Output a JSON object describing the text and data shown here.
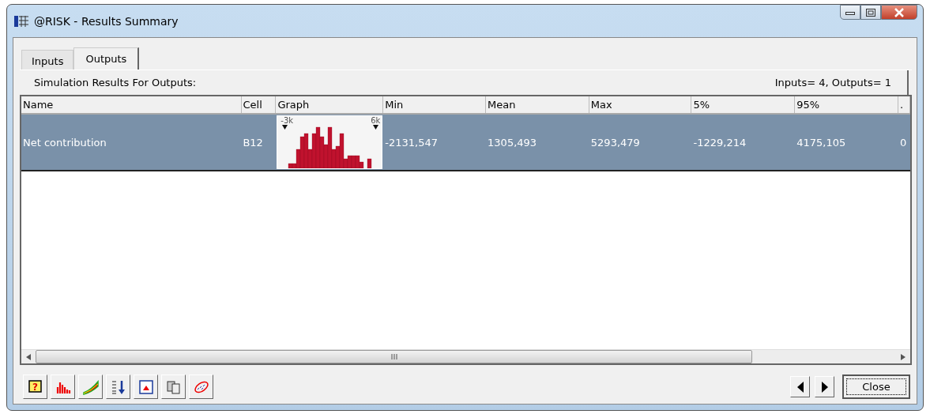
{
  "window": {
    "title": "@RISK - Results Summary"
  },
  "tabs": [
    {
      "label": "Inputs",
      "selected": false
    },
    {
      "label": "Outputs",
      "selected": true
    }
  ],
  "header": {
    "title": "Simulation Results For Outputs:",
    "counts": "Inputs= 4, Outputs= 1"
  },
  "table": {
    "columns": [
      "Name",
      "Cell",
      "Graph",
      "Min",
      "Mean",
      "Max",
      "5%",
      "95%",
      "."
    ],
    "rows": [
      {
        "selected": true,
        "name": "Net contribution",
        "cell": "B12",
        "graph": {
          "left_label": "-3k",
          "right_label": "6k"
        },
        "values": [
          "-2131,547",
          "1305,493",
          "5293,479",
          "-1229,214",
          "4175,105",
          "0"
        ]
      }
    ]
  },
  "buttons": {
    "help_symbol": "?",
    "close": "Close"
  }
}
